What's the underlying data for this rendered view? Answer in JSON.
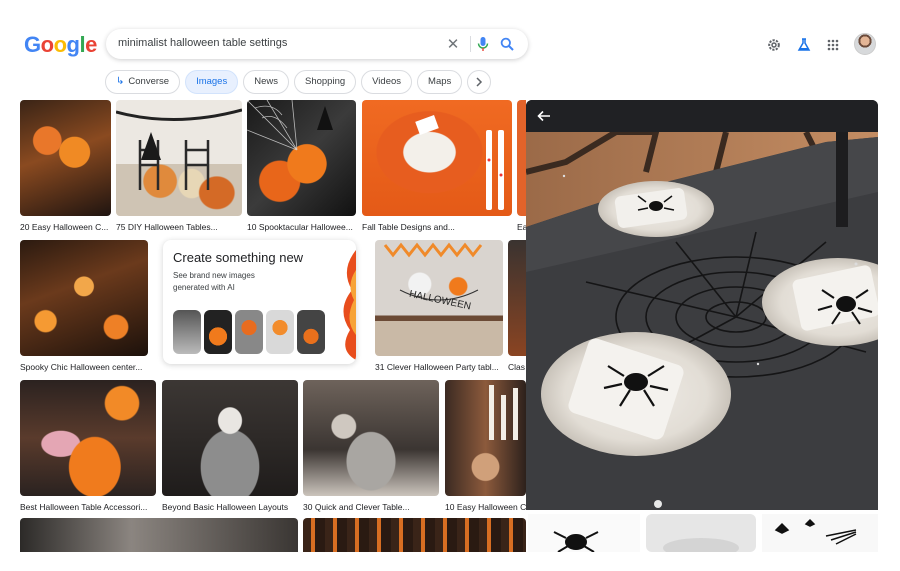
{
  "brand": {
    "logo_letters": [
      "G",
      "o",
      "o",
      "g",
      "l",
      "e"
    ],
    "logo_colors": [
      "#4285f4",
      "#ea4335",
      "#fbbc05",
      "#4285f4",
      "#34a853",
      "#ea4335"
    ]
  },
  "search": {
    "query": "minimalist halloween table settings"
  },
  "header_icons": [
    "settings-gear-icon",
    "labs-flask-icon",
    "apps-grid-icon",
    "account-avatar"
  ],
  "chips": [
    {
      "label": "Converse",
      "icon": "converse-arrow-icon",
      "active": false
    },
    {
      "label": "Images",
      "active": true
    },
    {
      "label": "News",
      "active": false
    },
    {
      "label": "Shopping",
      "active": false
    },
    {
      "label": "Videos",
      "active": false
    },
    {
      "label": "Maps",
      "active": false
    }
  ],
  "results": {
    "row1": [
      "20 Easy Halloween C...",
      "75 DIY Halloween Tables...",
      "10 Spooktacular Hallowee...",
      "Fall Table Designs and...",
      "Ea"
    ],
    "row2": [
      "Spooky Chic Halloween center...",
      "31 Clever Halloween Party tabl...",
      "Clas"
    ],
    "row3": [
      "Best Halloween Table Accessori...",
      "Beyond Basic Halloween Layouts",
      "30 Quick and Clever Table...",
      "10 Easy Halloween C"
    ]
  },
  "ai_card": {
    "title": "Create something new",
    "subtitle": "See brand new images generated with AI"
  },
  "preview": {
    "back_icon": "arrow-left-icon"
  },
  "colors": {
    "accent": "#1a73e8",
    "active_chip_bg": "#e8f0fe",
    "panel_bg": "#202124"
  }
}
